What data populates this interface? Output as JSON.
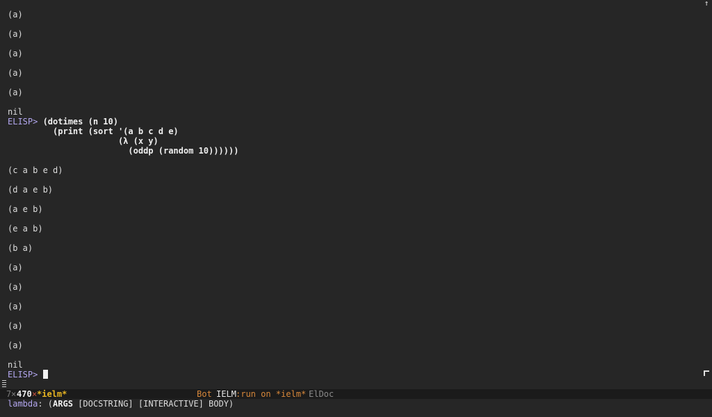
{
  "buffer": {
    "lines": [
      {
        "kind": "output",
        "text": "(a)"
      },
      {
        "kind": "output",
        "text": "(a)"
      },
      {
        "kind": "output",
        "text": "(a)"
      },
      {
        "kind": "output",
        "text": "(a)"
      },
      {
        "kind": "output",
        "text": "(a)"
      },
      {
        "kind": "result",
        "text": "nil"
      },
      {
        "kind": "prompt",
        "prompt": "ELISP> ",
        "text": "(dotimes (n 10)"
      },
      {
        "kind": "input",
        "text": "         (print (sort '(a b c d e)"
      },
      {
        "kind": "input",
        "text": "                      (λ (x y)"
      },
      {
        "kind": "input",
        "text": "                        (oddp (random 10))))))"
      },
      {
        "kind": "output",
        "text": "(c a b e d)"
      },
      {
        "kind": "output",
        "text": "(d a e b)"
      },
      {
        "kind": "output",
        "text": "(a e b)"
      },
      {
        "kind": "output",
        "text": "(e a b)"
      },
      {
        "kind": "output",
        "text": "(b a)"
      },
      {
        "kind": "output",
        "text": "(a)"
      },
      {
        "kind": "output",
        "text": "(a)"
      },
      {
        "kind": "output",
        "text": "(a)"
      },
      {
        "kind": "output",
        "text": "(a)"
      },
      {
        "kind": "output",
        "text": "(a)"
      },
      {
        "kind": "result",
        "text": "nil"
      },
      {
        "kind": "prompt",
        "prompt": "ELISP> ",
        "text": ""
      }
    ]
  },
  "modeline": {
    "column": "7",
    "separator": "×",
    "line": "470",
    "modified_flag": "×",
    "buffer_name": "*ielm*",
    "position": "Bot",
    "major_mode": "IELM",
    "process": ":run on *ielm*",
    "minor_modes": "ElDoc"
  },
  "echo": {
    "function": "lambda",
    "colon": ": (",
    "args_bold": "ARGS",
    "args_rest": " [DOCSTRING] [INTERACTIVE] BODY)"
  },
  "colors": {
    "background": "#262626",
    "prompt": "#b2a6ee",
    "buffer_name": "#e6b422",
    "position": "#d7873a"
  },
  "icons": {
    "scroll_up": "arrow-up-icon",
    "scroll_corner": "corner-bracket-icon",
    "fringe": "continuation-fringe-icon"
  }
}
